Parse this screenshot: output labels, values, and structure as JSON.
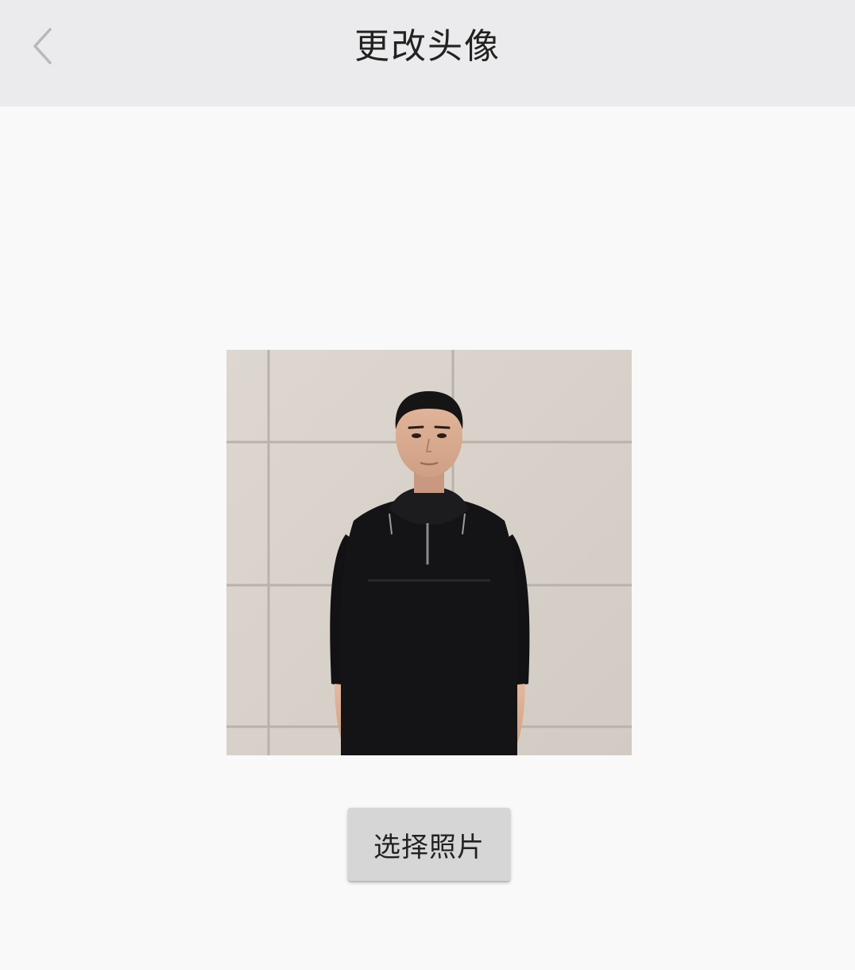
{
  "nav": {
    "title": "更改头像",
    "back_icon": "chevron-left-icon"
  },
  "avatar": {
    "kind": "profile-photo"
  },
  "actions": {
    "select_photo_label": "选择照片"
  },
  "colors": {
    "nav_background": "#ebebed",
    "page_background": "#f9f9f9",
    "button_background": "#d6d6d6",
    "title_text": "#222222",
    "back_icon": "#b8b8bc"
  }
}
